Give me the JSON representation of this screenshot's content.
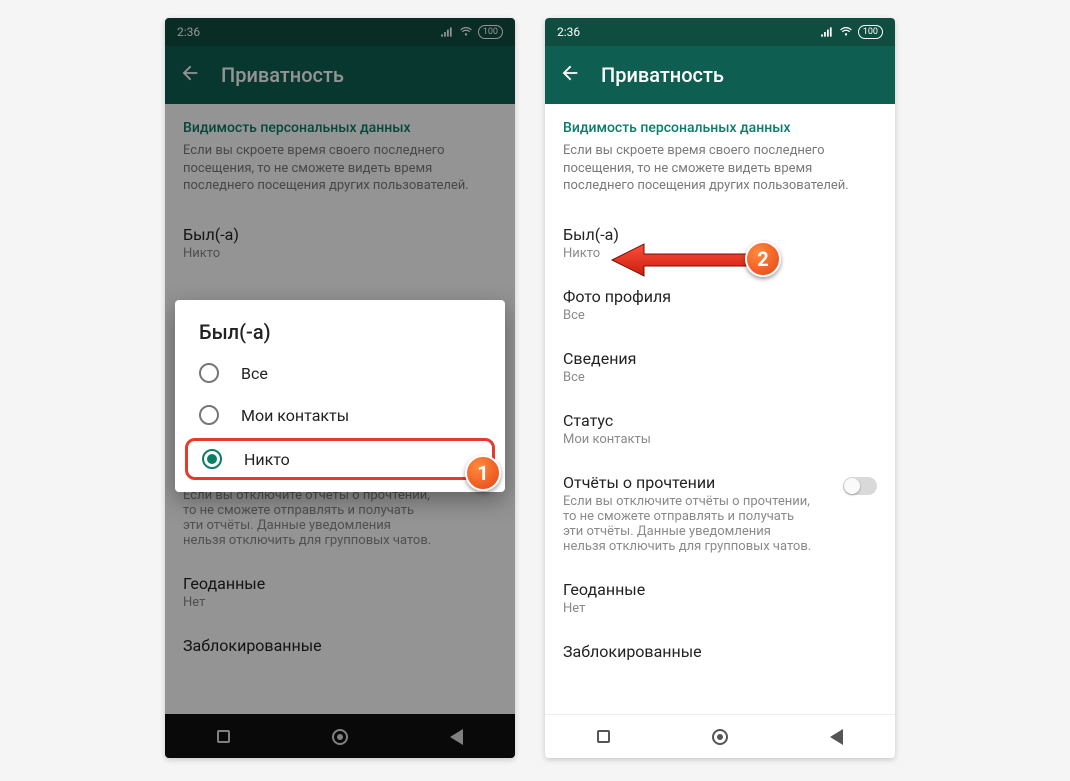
{
  "status": {
    "time": "2:36",
    "battery": "100"
  },
  "appbar": {
    "title": "Приватность"
  },
  "section": {
    "heading": "Видимость персональных данных",
    "description": "Если вы скроете время своего последнего посещения, то не сможете видеть время последнего посещения других пользователей."
  },
  "items": {
    "lastseen": {
      "label": "Был(-а)",
      "value": "Никто"
    },
    "photo": {
      "label": "Фото профиля",
      "value": "Все"
    },
    "about": {
      "label": "Сведения",
      "value": "Все"
    },
    "statusmsg": {
      "label": "Статус",
      "value": "Мои контакты"
    },
    "readrcpt": {
      "label": "Отчёты о прочтении",
      "desc": "Если вы отключите отчёты о прочтении, то не сможете отправлять и получать эти отчёты. Данные уведомления нельзя отключить для групповых чатов."
    },
    "geo": {
      "label": "Геоданные",
      "value": "Нет"
    },
    "blocked": {
      "label": "Заблокированные"
    }
  },
  "dialog": {
    "title": "Был(-а)",
    "options": [
      "Все",
      "Мои контакты",
      "Никто"
    ],
    "selected": 2
  },
  "badges": {
    "one": "1",
    "two": "2"
  }
}
